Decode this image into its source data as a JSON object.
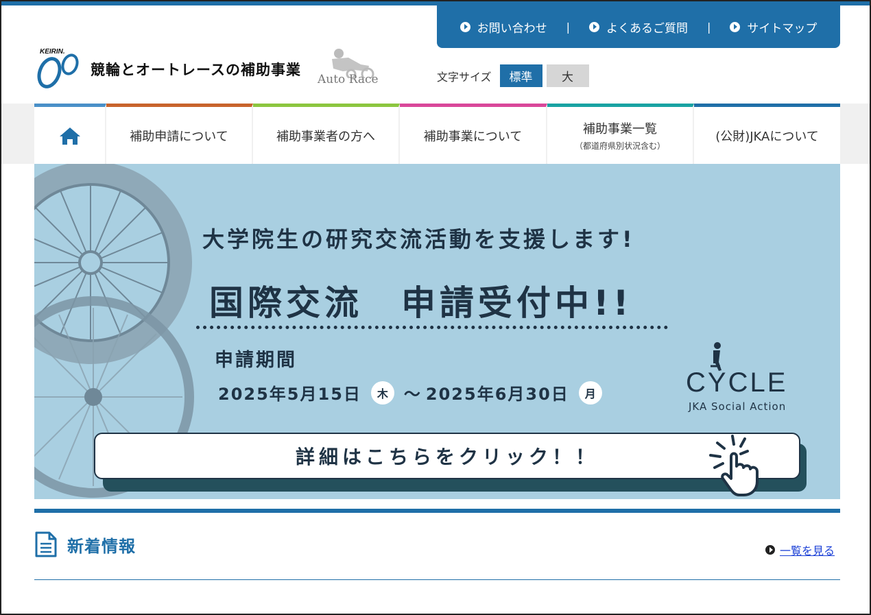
{
  "utility_nav": {
    "contact": "お問い合わせ",
    "faq": "よくあるご質問",
    "sitemap": "サイトマップ",
    "separator": "|"
  },
  "logo": {
    "mark_text": "KEIRIN",
    "site_name": "競輪とオートレースの補助事業",
    "autorace_text": "Auto Race"
  },
  "font_size": {
    "label": "文字サイズ",
    "standard": "標準",
    "large": "大",
    "selected": "標準"
  },
  "global_nav": {
    "home_icon": "home-icon",
    "items": [
      {
        "label": "補助申請について",
        "color": "#c8642c"
      },
      {
        "label": "補助事業者の方へ",
        "color": "#8cc63f"
      },
      {
        "label": "補助事業について",
        "color": "#d9489a"
      },
      {
        "label": "補助事業一覧",
        "sub": "（都道府県別状況含む）",
        "color": "#1aa3a3"
      },
      {
        "label": "(公財)JKAについて",
        "color": "#1f6fa8"
      }
    ],
    "home_color": "#4a90c8"
  },
  "banner": {
    "lead": "大学院生の研究交流活動を支援します!",
    "headline": "国際交流　申請受付中!!",
    "period_label": "申請期間",
    "start_date": "2025年5月15日",
    "start_day": "木",
    "tilde": "～",
    "end_date": "2025年6月30日",
    "end_day": "月",
    "cycle_word": "CYCLE",
    "cycle_sub": "JKA Social Action",
    "cta": "詳細はこちらをクリック！！",
    "background": "#a9cfe1",
    "text_color": "#1f3345"
  },
  "news": {
    "title": "新着情報",
    "view_all": "一覧を見る",
    "icon": "document-icon"
  },
  "colors": {
    "brand": "#1f6fa8"
  }
}
